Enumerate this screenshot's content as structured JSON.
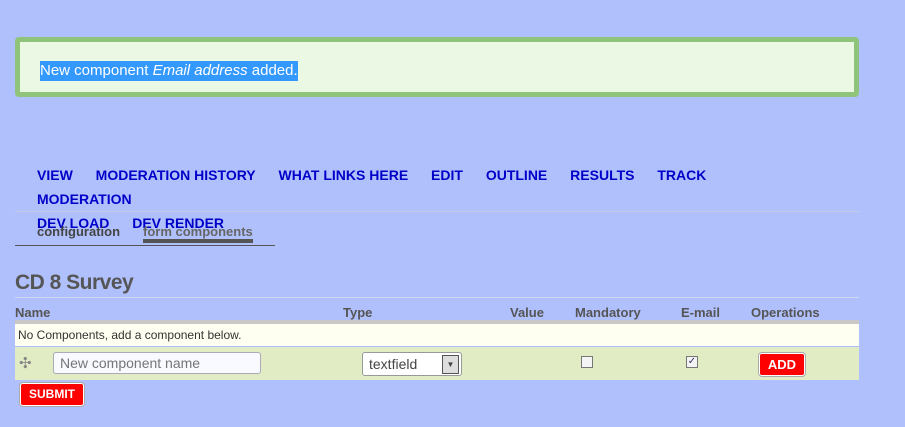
{
  "message": {
    "prefix": "New component ",
    "component": "Email address",
    "suffix": " added."
  },
  "tabs": [
    "VIEW",
    "MODERATION HISTORY",
    "WHAT LINKS HERE",
    "EDIT",
    "OUTLINE",
    "RESULTS",
    "TRACK",
    "MODERATION",
    "DEV LOAD",
    "DEV RENDER"
  ],
  "subtabs": {
    "configuration": "configuration",
    "form_components": "form components"
  },
  "page_title": "CD 8 Survey",
  "table": {
    "headers": {
      "name": "Name",
      "type": "Type",
      "value": "Value",
      "mandatory": "Mandatory",
      "email": "E-mail",
      "operations": "Operations"
    },
    "empty_text": "No Components, add a component below.",
    "new_row": {
      "name_placeholder": "New component name",
      "type": "textfield",
      "mandatory": false,
      "email": true,
      "add_label": "ADD"
    }
  },
  "submit_label": "SUBMIT"
}
